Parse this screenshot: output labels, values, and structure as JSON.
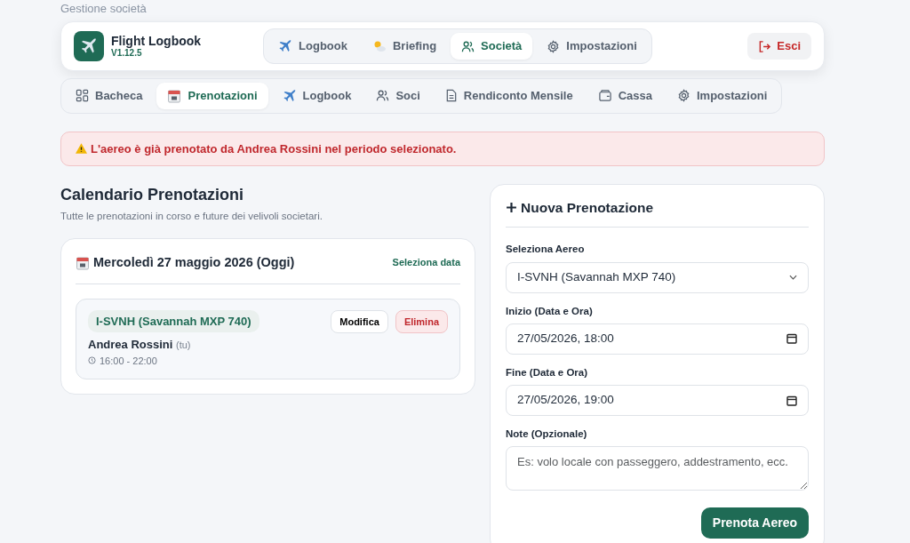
{
  "page_title": "Gestione società",
  "app": {
    "name": "Flight Logbook",
    "version": "V1.12.5"
  },
  "main_nav": [
    {
      "label": "Logbook",
      "selected": false
    },
    {
      "label": "Briefing",
      "selected": false
    },
    {
      "label": "Società",
      "selected": true
    },
    {
      "label": "Impostazioni",
      "selected": false
    }
  ],
  "logout": "Esci",
  "sub_tabs": [
    {
      "label": "Bacheca",
      "selected": false
    },
    {
      "label": "Prenotazioni",
      "selected": true
    },
    {
      "label": "Logbook",
      "selected": false
    },
    {
      "label": "Soci",
      "selected": false
    },
    {
      "label": "Rendiconto Mensile",
      "selected": false
    },
    {
      "label": "Cassa",
      "selected": false
    },
    {
      "label": "Impostazioni",
      "selected": false
    }
  ],
  "alert": "L'aereo è già prenotato da Andrea Rossini nel periodo selezionato.",
  "calendar": {
    "title": "Calendario Prenotazioni",
    "subtitle": "Tutte le prenotazioni in corso e future dei velivoli societari.",
    "date": "Mercoledì 27 maggio 2026 (Oggi)",
    "select_date": "Seleziona data",
    "bookings": [
      {
        "aircraft": "I-SVNH (Savannah MXP 740)",
        "pilot": "Andrea Rossini",
        "pilot_note": "(tu)",
        "time": "16:00 - 22:00",
        "edit": "Modifica",
        "delete": "Elimina"
      }
    ]
  },
  "form": {
    "title": "Nuova Prenotazione",
    "aircraft_label": "Seleziona Aereo",
    "aircraft": "I-SVNH (Savannah MXP 740)",
    "start_label": "Inizio (Data e Ora)",
    "start": "27/05/2026, 18:00",
    "end_label": "Fine (Data e Ora)",
    "end": "27/05/2026, 19:00",
    "notes_label": "Note (Opzionale)",
    "notes_placeholder": "Es: volo locale con passeggero, addestramento, ecc.",
    "submit": "Prenota Aereo"
  }
}
